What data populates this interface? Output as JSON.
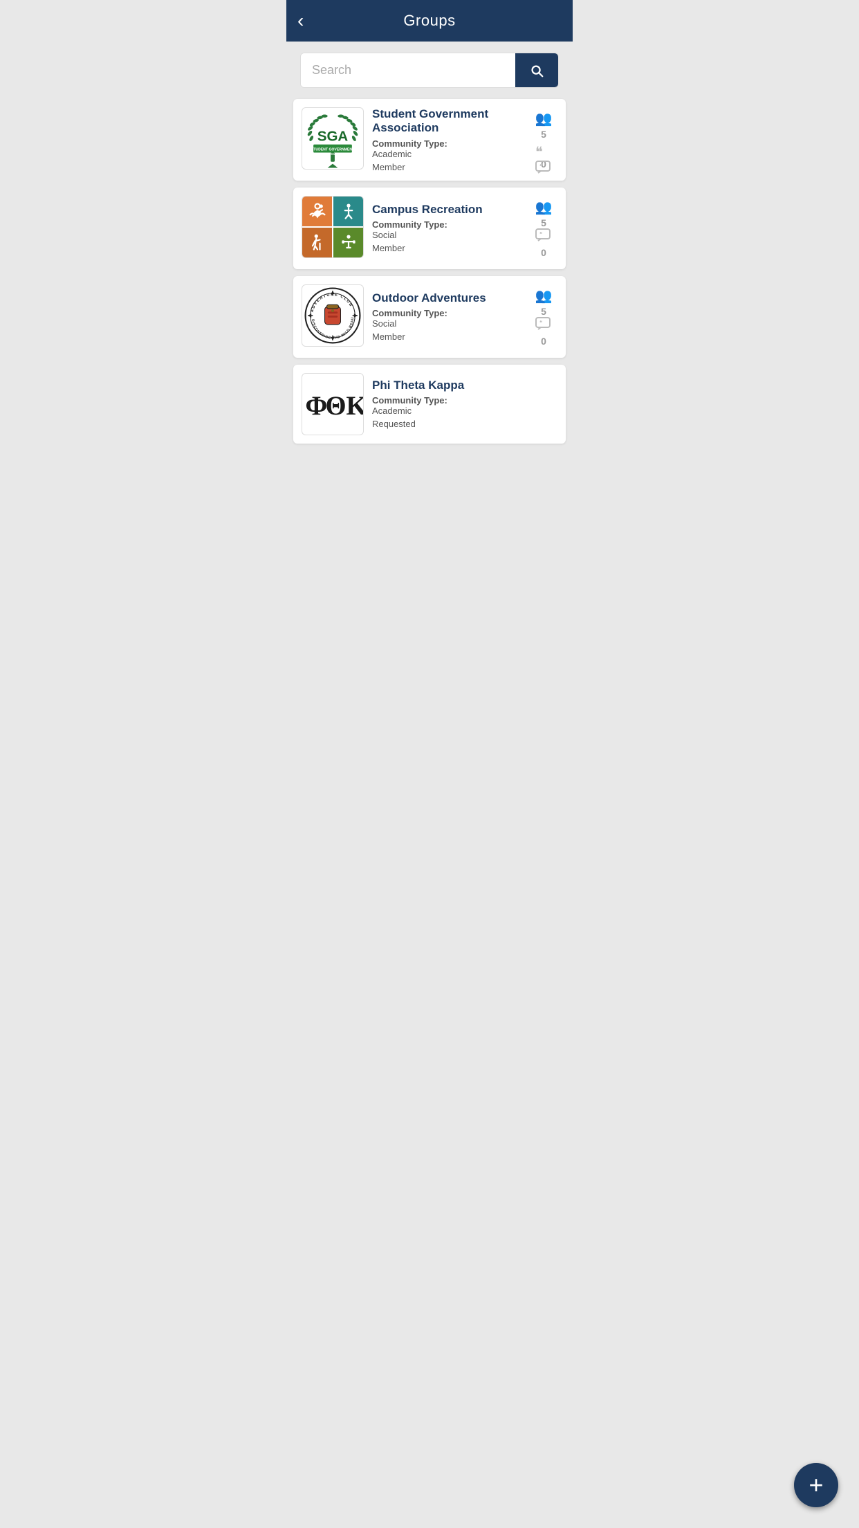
{
  "header": {
    "title": "Groups",
    "back_label": "‹"
  },
  "search": {
    "placeholder": "Search",
    "button_label": "Search"
  },
  "groups": [
    {
      "id": "sga",
      "name": "Student Government Association",
      "community_type_label": "Community Type:",
      "community_type": "Academic",
      "status": "Member",
      "member_count": "5",
      "message_count": "0"
    },
    {
      "id": "campus-rec",
      "name": "Campus Recreation",
      "community_type_label": "Community Type:",
      "community_type": "Social",
      "status": "Member",
      "member_count": "5",
      "message_count": "0"
    },
    {
      "id": "outdoor-adventures",
      "name": "Outdoor Adventures",
      "community_type_label": "Community Type:",
      "community_type": "Social",
      "status": "Member",
      "member_count": "5",
      "message_count": "0"
    },
    {
      "id": "ptk",
      "name": "Phi Theta Kappa",
      "community_type_label": "Community Type:",
      "community_type": "Academic",
      "status": "Requested",
      "member_count": "",
      "message_count": ""
    }
  ],
  "fab": {
    "label": "+"
  },
  "colors": {
    "header_bg": "#1e3a5f",
    "accent": "#1e3a5f",
    "group_name": "#1e3a5f"
  }
}
